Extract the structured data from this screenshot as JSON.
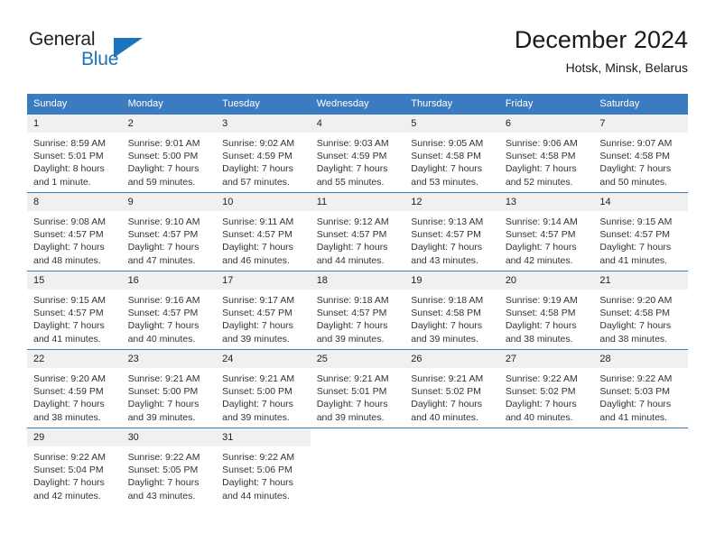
{
  "brand": {
    "word1": "General",
    "word2": "Blue",
    "triangle_color": "#1c75bc",
    "text_color": "#231f20"
  },
  "header": {
    "title": "December 2024",
    "subtitle": "Hotsk, Minsk, Belarus"
  },
  "theme": {
    "header_bg": "#3b7cc0",
    "header_text": "#ffffff",
    "daynum_bg": "#f0f0f0",
    "cell_bg": "#ffffff",
    "grid_line": "#3b7cc0"
  },
  "calendar": {
    "weekdays": [
      "Sunday",
      "Monday",
      "Tuesday",
      "Wednesday",
      "Thursday",
      "Friday",
      "Saturday"
    ],
    "weeks": [
      [
        {
          "day": "1",
          "sunrise": "Sunrise: 8:59 AM",
          "sunset": "Sunset: 5:01 PM",
          "daylight1": "Daylight: 8 hours",
          "daylight2": "and 1 minute."
        },
        {
          "day": "2",
          "sunrise": "Sunrise: 9:01 AM",
          "sunset": "Sunset: 5:00 PM",
          "daylight1": "Daylight: 7 hours",
          "daylight2": "and 59 minutes."
        },
        {
          "day": "3",
          "sunrise": "Sunrise: 9:02 AM",
          "sunset": "Sunset: 4:59 PM",
          "daylight1": "Daylight: 7 hours",
          "daylight2": "and 57 minutes."
        },
        {
          "day": "4",
          "sunrise": "Sunrise: 9:03 AM",
          "sunset": "Sunset: 4:59 PM",
          "daylight1": "Daylight: 7 hours",
          "daylight2": "and 55 minutes."
        },
        {
          "day": "5",
          "sunrise": "Sunrise: 9:05 AM",
          "sunset": "Sunset: 4:58 PM",
          "daylight1": "Daylight: 7 hours",
          "daylight2": "and 53 minutes."
        },
        {
          "day": "6",
          "sunrise": "Sunrise: 9:06 AM",
          "sunset": "Sunset: 4:58 PM",
          "daylight1": "Daylight: 7 hours",
          "daylight2": "and 52 minutes."
        },
        {
          "day": "7",
          "sunrise": "Sunrise: 9:07 AM",
          "sunset": "Sunset: 4:58 PM",
          "daylight1": "Daylight: 7 hours",
          "daylight2": "and 50 minutes."
        }
      ],
      [
        {
          "day": "8",
          "sunrise": "Sunrise: 9:08 AM",
          "sunset": "Sunset: 4:57 PM",
          "daylight1": "Daylight: 7 hours",
          "daylight2": "and 48 minutes."
        },
        {
          "day": "9",
          "sunrise": "Sunrise: 9:10 AM",
          "sunset": "Sunset: 4:57 PM",
          "daylight1": "Daylight: 7 hours",
          "daylight2": "and 47 minutes."
        },
        {
          "day": "10",
          "sunrise": "Sunrise: 9:11 AM",
          "sunset": "Sunset: 4:57 PM",
          "daylight1": "Daylight: 7 hours",
          "daylight2": "and 46 minutes."
        },
        {
          "day": "11",
          "sunrise": "Sunrise: 9:12 AM",
          "sunset": "Sunset: 4:57 PM",
          "daylight1": "Daylight: 7 hours",
          "daylight2": "and 44 minutes."
        },
        {
          "day": "12",
          "sunrise": "Sunrise: 9:13 AM",
          "sunset": "Sunset: 4:57 PM",
          "daylight1": "Daylight: 7 hours",
          "daylight2": "and 43 minutes."
        },
        {
          "day": "13",
          "sunrise": "Sunrise: 9:14 AM",
          "sunset": "Sunset: 4:57 PM",
          "daylight1": "Daylight: 7 hours",
          "daylight2": "and 42 minutes."
        },
        {
          "day": "14",
          "sunrise": "Sunrise: 9:15 AM",
          "sunset": "Sunset: 4:57 PM",
          "daylight1": "Daylight: 7 hours",
          "daylight2": "and 41 minutes."
        }
      ],
      [
        {
          "day": "15",
          "sunrise": "Sunrise: 9:15 AM",
          "sunset": "Sunset: 4:57 PM",
          "daylight1": "Daylight: 7 hours",
          "daylight2": "and 41 minutes."
        },
        {
          "day": "16",
          "sunrise": "Sunrise: 9:16 AM",
          "sunset": "Sunset: 4:57 PM",
          "daylight1": "Daylight: 7 hours",
          "daylight2": "and 40 minutes."
        },
        {
          "day": "17",
          "sunrise": "Sunrise: 9:17 AM",
          "sunset": "Sunset: 4:57 PM",
          "daylight1": "Daylight: 7 hours",
          "daylight2": "and 39 minutes."
        },
        {
          "day": "18",
          "sunrise": "Sunrise: 9:18 AM",
          "sunset": "Sunset: 4:57 PM",
          "daylight1": "Daylight: 7 hours",
          "daylight2": "and 39 minutes."
        },
        {
          "day": "19",
          "sunrise": "Sunrise: 9:18 AM",
          "sunset": "Sunset: 4:58 PM",
          "daylight1": "Daylight: 7 hours",
          "daylight2": "and 39 minutes."
        },
        {
          "day": "20",
          "sunrise": "Sunrise: 9:19 AM",
          "sunset": "Sunset: 4:58 PM",
          "daylight1": "Daylight: 7 hours",
          "daylight2": "and 38 minutes."
        },
        {
          "day": "21",
          "sunrise": "Sunrise: 9:20 AM",
          "sunset": "Sunset: 4:58 PM",
          "daylight1": "Daylight: 7 hours",
          "daylight2": "and 38 minutes."
        }
      ],
      [
        {
          "day": "22",
          "sunrise": "Sunrise: 9:20 AM",
          "sunset": "Sunset: 4:59 PM",
          "daylight1": "Daylight: 7 hours",
          "daylight2": "and 38 minutes."
        },
        {
          "day": "23",
          "sunrise": "Sunrise: 9:21 AM",
          "sunset": "Sunset: 5:00 PM",
          "daylight1": "Daylight: 7 hours",
          "daylight2": "and 39 minutes."
        },
        {
          "day": "24",
          "sunrise": "Sunrise: 9:21 AM",
          "sunset": "Sunset: 5:00 PM",
          "daylight1": "Daylight: 7 hours",
          "daylight2": "and 39 minutes."
        },
        {
          "day": "25",
          "sunrise": "Sunrise: 9:21 AM",
          "sunset": "Sunset: 5:01 PM",
          "daylight1": "Daylight: 7 hours",
          "daylight2": "and 39 minutes."
        },
        {
          "day": "26",
          "sunrise": "Sunrise: 9:21 AM",
          "sunset": "Sunset: 5:02 PM",
          "daylight1": "Daylight: 7 hours",
          "daylight2": "and 40 minutes."
        },
        {
          "day": "27",
          "sunrise": "Sunrise: 9:22 AM",
          "sunset": "Sunset: 5:02 PM",
          "daylight1": "Daylight: 7 hours",
          "daylight2": "and 40 minutes."
        },
        {
          "day": "28",
          "sunrise": "Sunrise: 9:22 AM",
          "sunset": "Sunset: 5:03 PM",
          "daylight1": "Daylight: 7 hours",
          "daylight2": "and 41 minutes."
        }
      ],
      [
        {
          "day": "29",
          "sunrise": "Sunrise: 9:22 AM",
          "sunset": "Sunset: 5:04 PM",
          "daylight1": "Daylight: 7 hours",
          "daylight2": "and 42 minutes."
        },
        {
          "day": "30",
          "sunrise": "Sunrise: 9:22 AM",
          "sunset": "Sunset: 5:05 PM",
          "daylight1": "Daylight: 7 hours",
          "daylight2": "and 43 minutes."
        },
        {
          "day": "31",
          "sunrise": "Sunrise: 9:22 AM",
          "sunset": "Sunset: 5:06 PM",
          "daylight1": "Daylight: 7 hours",
          "daylight2": "and 44 minutes."
        },
        {
          "day": "",
          "sunrise": "",
          "sunset": "",
          "daylight1": "",
          "daylight2": ""
        },
        {
          "day": "",
          "sunrise": "",
          "sunset": "",
          "daylight1": "",
          "daylight2": ""
        },
        {
          "day": "",
          "sunrise": "",
          "sunset": "",
          "daylight1": "",
          "daylight2": ""
        },
        {
          "day": "",
          "sunrise": "",
          "sunset": "",
          "daylight1": "",
          "daylight2": ""
        }
      ]
    ]
  }
}
